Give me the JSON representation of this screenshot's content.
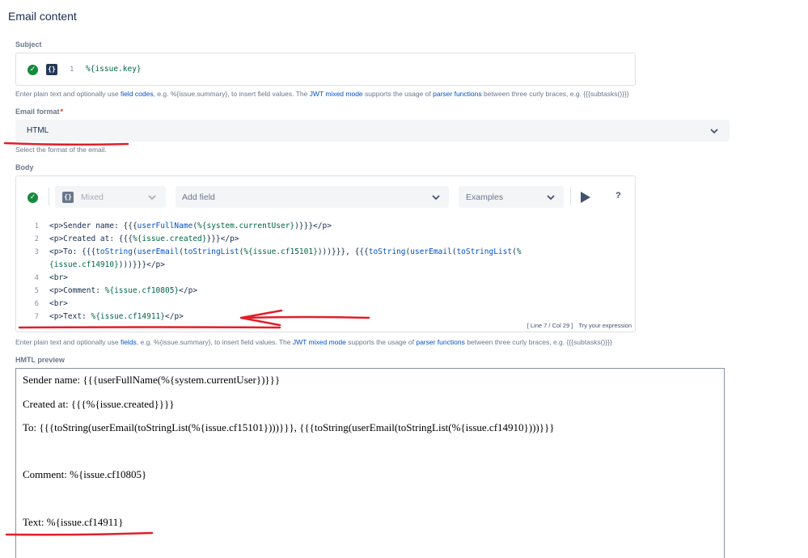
{
  "page": {
    "title": "Email content"
  },
  "subject": {
    "label": "Subject",
    "line_number": "1",
    "value": "%{issue.key}",
    "help_pre": "Enter plain text and optionally use ",
    "help_link1": "field codes",
    "help_mid1": ", e.g. %{issue.summary}, to insert field values. The ",
    "help_link2": "JWT mixed mode",
    "help_mid2": " supports the usage of ",
    "help_link3": "parser functions",
    "help_post": " between three curly braces, e.g. {{{subtasks()}}}"
  },
  "email_format": {
    "label": "Email format",
    "required_mark": "*",
    "selected": "HTML",
    "help": "Select the format of the email."
  },
  "body": {
    "label": "Body",
    "toolbar": {
      "mode": "Mixed",
      "add_field": "Add field",
      "examples": "Examples",
      "help_symbol": "?"
    },
    "lines": [
      {
        "n": "1",
        "segments": [
          {
            "t": "tag",
            "v": "<p>Sender name: {{{"
          },
          {
            "t": "fn",
            "v": "userFullName"
          },
          {
            "t": "tag",
            "v": "("
          },
          {
            "t": "fld",
            "v": "%{system.currentUser}"
          },
          {
            "t": "tag",
            "v": ")}}}</p>"
          }
        ]
      },
      {
        "n": "2",
        "segments": [
          {
            "t": "tag",
            "v": "<p>Created at: {{{"
          },
          {
            "t": "fld",
            "v": "%{issue.created}"
          },
          {
            "t": "tag",
            "v": "}}}</p>"
          }
        ]
      },
      {
        "n": "3",
        "segments": [
          {
            "t": "tag",
            "v": "<p>To: {{{"
          },
          {
            "t": "fn",
            "v": "toString"
          },
          {
            "t": "tag",
            "v": "("
          },
          {
            "t": "fn",
            "v": "userEmail"
          },
          {
            "t": "tag",
            "v": "("
          },
          {
            "t": "fn",
            "v": "toStringList"
          },
          {
            "t": "tag",
            "v": "("
          },
          {
            "t": "fld",
            "v": "%{issue.cf15101}"
          },
          {
            "t": "tag",
            "v": ")))}}}, {{{"
          },
          {
            "t": "fn",
            "v": "toString"
          },
          {
            "t": "tag",
            "v": "("
          },
          {
            "t": "fn",
            "v": "userEmail"
          },
          {
            "t": "tag",
            "v": "("
          },
          {
            "t": "fn",
            "v": "toStringList"
          },
          {
            "t": "tag",
            "v": "("
          },
          {
            "t": "fld",
            "v": "%"
          }
        ]
      },
      {
        "n": "",
        "segments": [
          {
            "t": "fld",
            "v": "{issue.cf14910}"
          },
          {
            "t": "tag",
            "v": ")))}}}</p>"
          }
        ]
      },
      {
        "n": "4",
        "segments": [
          {
            "t": "tag",
            "v": "<br>"
          }
        ]
      },
      {
        "n": "5",
        "segments": [
          {
            "t": "tag",
            "v": "<p>Comment: "
          },
          {
            "t": "fld",
            "v": "%{issue.cf10805}"
          },
          {
            "t": "tag",
            "v": "</p>"
          }
        ]
      },
      {
        "n": "6",
        "segments": [
          {
            "t": "tag",
            "v": "<br>"
          }
        ]
      },
      {
        "n": "7",
        "segments": [
          {
            "t": "tag",
            "v": "<p>Text: "
          },
          {
            "t": "fld",
            "v": "%{issue.cf14911}"
          },
          {
            "t": "tag",
            "v": "</p>"
          }
        ]
      }
    ],
    "status_position": "[ Line 7 / Col 29 ]",
    "status_action": "Try your expression",
    "help_pre": "Enter plain text and optionally use ",
    "help_link1": "fields",
    "help_mid1": ", e.g. %{issue.summary}, to insert field values. The ",
    "help_link2": "JWT mixed mode",
    "help_mid2": " supports the usage of ",
    "help_link3": "parser functions",
    "help_post": " between three curly braces, e.g. {{{subtasks()}}}"
  },
  "preview": {
    "label": "HMTL preview",
    "lines": [
      "Sender name: {{{userFullName(%{system.currentUser})}}}",
      "Created at: {{{%{issue.created}}}}",
      "To: {{{toString(userEmail(toStringList(%{issue.cf15101})))}}}, {{{toString(userEmail(toStringList(%{issue.cf14910})))}}}",
      "Comment: %{issue.cf10805}",
      "Text: %{issue.cf14911}"
    ]
  },
  "colors": {
    "annotation_red": "#e0202a",
    "success_green": "#168a3d",
    "link_blue": "#0052cc"
  }
}
